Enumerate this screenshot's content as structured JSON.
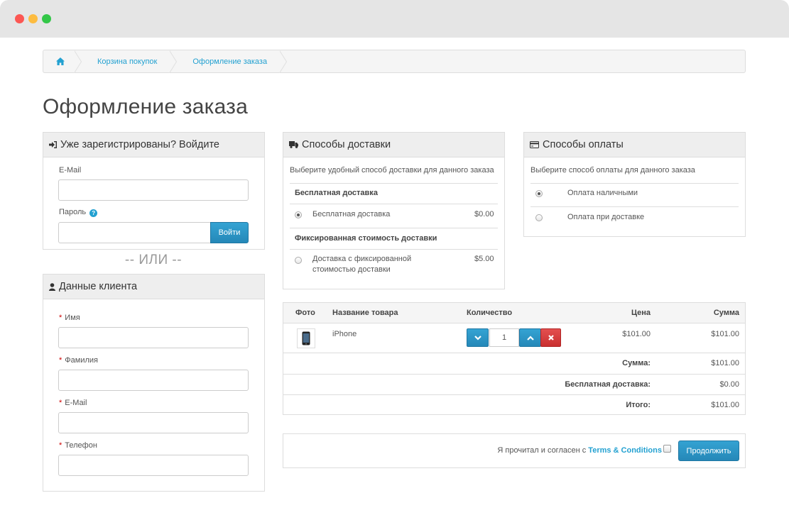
{
  "breadcrumb": {
    "home_icon": "home-icon",
    "items": [
      "Корзина покупок",
      "Оформление заказа"
    ]
  },
  "page_title": "Оформление заказа",
  "login": {
    "title": "Уже зарегистрированы? Войдите",
    "title_icon": "sign-in-icon",
    "email_label": "E-Mail",
    "password_label": "Пароль",
    "help_icon": "question-circle-icon",
    "submit_label": "Войти"
  },
  "or_separator": "-- ИЛИ --",
  "customer": {
    "title": "Данные клиента",
    "title_icon": "user-icon",
    "required_mark": "*",
    "first_name_label": "Имя",
    "last_name_label": "Фамилия",
    "email_label": "E-Mail",
    "phone_label": "Телефон"
  },
  "shipping": {
    "title": "Способы доставки",
    "title_icon": "truck-icon",
    "description": "Выберите удобный способ доставки для данного заказа",
    "groups": [
      {
        "name": "Бесплатная доставка",
        "option": "Бесплатная доставка",
        "price": "$0.00",
        "selected": true
      },
      {
        "name": "Фиксированная стоимость доставки",
        "option_line1": "Доставка с фиксированной",
        "option_line2": "стоимостью доставки",
        "price": "$5.00",
        "selected": false
      }
    ]
  },
  "payment": {
    "title": "Способы оплаты",
    "title_icon": "credit-card-icon",
    "description": "Выберите способ оплаты для данного заказа",
    "options": [
      {
        "label": "Оплата наличными",
        "selected": true
      },
      {
        "label": "Оплата при доставке",
        "selected": false
      }
    ]
  },
  "cart": {
    "columns": {
      "photo": "Фото",
      "name": "Название товара",
      "quantity": "Количество",
      "price": "Цена",
      "total": "Сумма"
    },
    "items": [
      {
        "name": "iPhone",
        "quantity": "1",
        "price": "$101.00",
        "total": "$101.00"
      }
    ],
    "totals": [
      {
        "label": "Сумма:",
        "value": "$101.00"
      },
      {
        "label": "Бесплатная доставка:",
        "value": "$0.00"
      },
      {
        "label": "Итого:",
        "value": "$101.00"
      }
    ]
  },
  "confirm": {
    "agree_text": "Я прочитал и согласен с ",
    "terms_link": "Terms & Conditions",
    "submit_label": "Продолжить"
  },
  "colors": {
    "accent": "#2a8fbd",
    "link": "#23a1d1",
    "danger": "#c92f2f",
    "required": "#cc0000"
  }
}
